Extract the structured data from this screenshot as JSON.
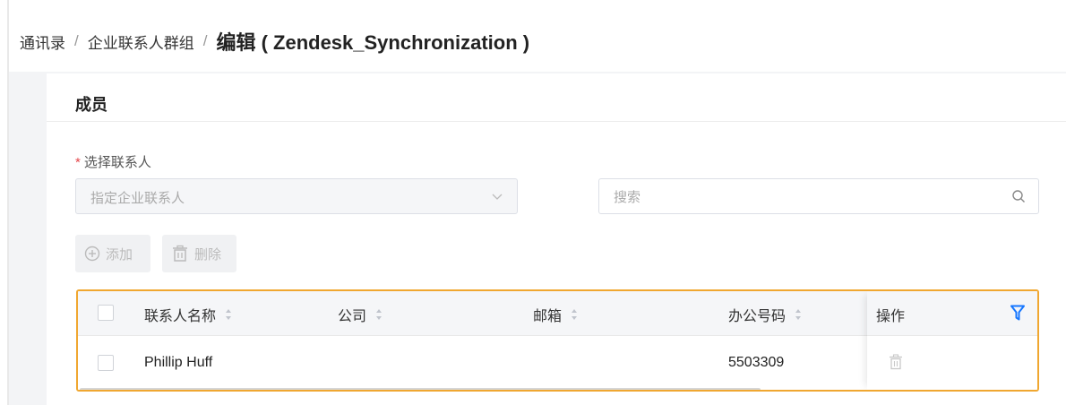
{
  "breadcrumb": {
    "items": [
      "通讯录",
      "企业联系人群组"
    ],
    "separator": "/",
    "current": "编辑 ( Zendesk_Synchronization )"
  },
  "card": {
    "title": "成员"
  },
  "form": {
    "required_mark": "*",
    "select_label": "选择联系人",
    "select_value": "指定企业联系人",
    "search_placeholder": "搜索"
  },
  "actions": {
    "add_label": "添加",
    "delete_label": "删除"
  },
  "table": {
    "columns": [
      "联系人名称",
      "公司",
      "邮箱",
      "办公号码",
      "操作"
    ],
    "rows": [
      {
        "name": "Phillip Huff",
        "company": "",
        "email": "",
        "office": "5503309"
      }
    ]
  },
  "colors": {
    "highlight_border": "#f0a730",
    "filter_icon": "#1677ff",
    "required": "#e5484d"
  },
  "icons": [
    "chevron-down-icon",
    "search-icon",
    "plus-circle-icon",
    "trash-icon",
    "sort-icon",
    "filter-icon"
  ]
}
